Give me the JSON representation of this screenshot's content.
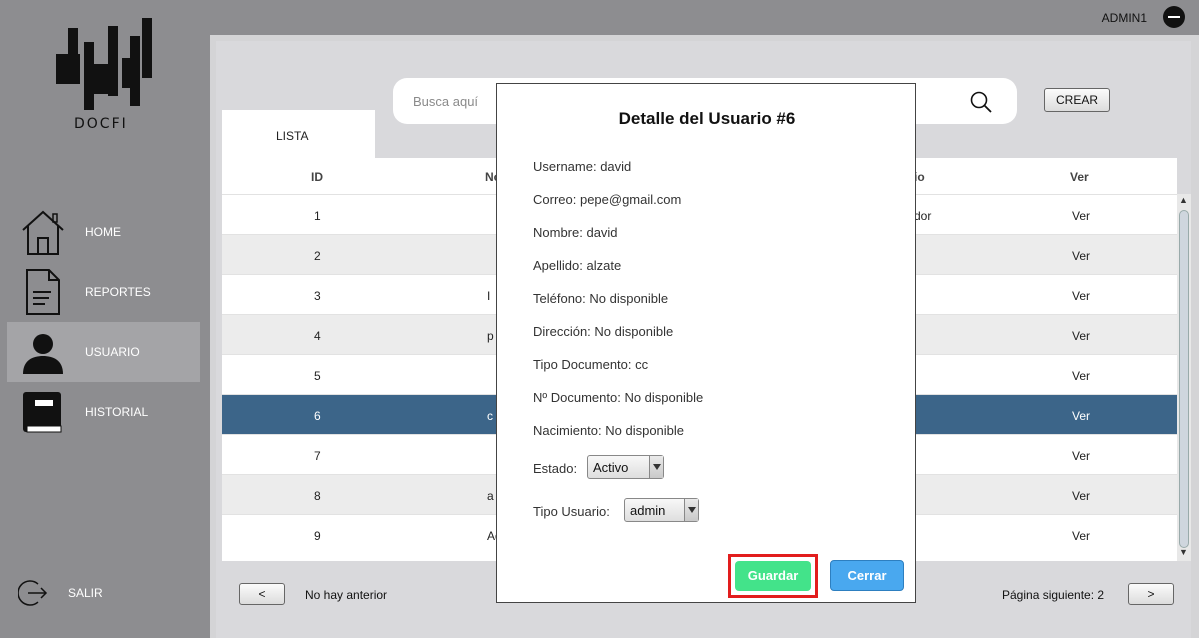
{
  "header": {
    "user": "ADMIN1"
  },
  "sidebar": {
    "logo_text": "DOCFI",
    "items": [
      {
        "label": "HOME",
        "icon": "home-icon"
      },
      {
        "label": "REPORTES",
        "icon": "document-icon"
      },
      {
        "label": "USUARIO",
        "icon": "user-icon"
      },
      {
        "label": "HISTORIAL",
        "icon": "book-icon"
      }
    ],
    "logout_label": "SALIR"
  },
  "search": {
    "placeholder": "Busca aquí"
  },
  "toolbar": {
    "create_label": "CREAR"
  },
  "tabs": {
    "list_label": "LISTA"
  },
  "table": {
    "headers": {
      "id": "ID",
      "name": "No",
      "role": "io",
      "view": "Ver"
    },
    "rows": [
      {
        "id": "1",
        "name": "",
        "role": "dor",
        "view": "Ver"
      },
      {
        "id": "2",
        "name": "",
        "role": "",
        "view": "Ver"
      },
      {
        "id": "3",
        "name": "I",
        "role": "",
        "view": "Ver"
      },
      {
        "id": "4",
        "name": "p",
        "role": "",
        "view": "Ver"
      },
      {
        "id": "5",
        "name": "",
        "role": "",
        "view": "Ver"
      },
      {
        "id": "6",
        "name": "c",
        "role": "",
        "view": "Ver"
      },
      {
        "id": "7",
        "name": "",
        "role": "",
        "view": "Ver"
      },
      {
        "id": "8",
        "name": "a",
        "role": "",
        "view": "Ver"
      },
      {
        "id": "9",
        "name": "Ad",
        "role": "",
        "view": "Ver"
      }
    ],
    "selected_row": "6"
  },
  "pagination": {
    "prev_label": "<",
    "prev_text": "No hay anterior",
    "next_text": "Página siguiente: 2",
    "next_label": ">"
  },
  "modal": {
    "title": "Detalle del Usuario #6",
    "username": "Username: david",
    "email": "Correo: pepe@gmail.com",
    "name": "Nombre: david",
    "lastname": "Apellido: alzate",
    "phone": "Teléfono: No disponible",
    "address": "Dirección: No disponible",
    "doc_type": "Tipo Documento: cc",
    "doc_number": "Nº Documento: No disponible",
    "birth": "Nacimiento: No disponible",
    "status_label": "Estado:",
    "status_value": "Activo",
    "usertype_label": "Tipo Usuario:",
    "usertype_value": "admin",
    "save_label": "Guardar",
    "close_label": "Cerrar"
  },
  "colors": {
    "selected_row": "#3c6589",
    "save_button": "#43e38a",
    "close_button": "#49a8ef",
    "highlight": "#e21d1d"
  }
}
